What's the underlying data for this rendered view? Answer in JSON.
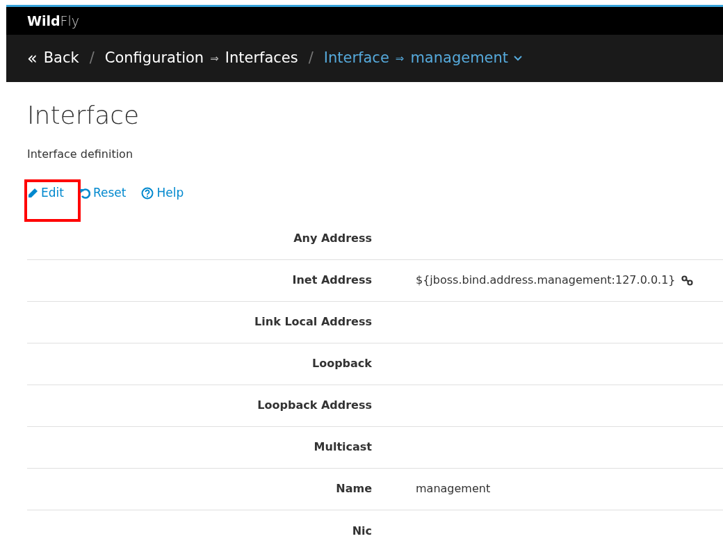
{
  "brand": {
    "bold": "Wild",
    "light": "Fly"
  },
  "breadcrumb": [
    {
      "kind": "back",
      "text": "«"
    },
    {
      "kind": "link",
      "text": "Back"
    },
    {
      "kind": "slash",
      "text": "/"
    },
    {
      "kind": "link",
      "text": "Configuration"
    },
    {
      "kind": "arrow",
      "text": "⇒"
    },
    {
      "kind": "link",
      "text": "Interfaces"
    },
    {
      "kind": "slash",
      "text": "/"
    },
    {
      "kind": "current",
      "text": "Interface"
    },
    {
      "kind": "current_arrow",
      "text": "⇒"
    },
    {
      "kind": "dropdown",
      "text": "management"
    }
  ],
  "title": "Interface",
  "description": "Interface definition",
  "actions": [
    {
      "label": "Edit",
      "kind": "edit",
      "highlighted": true
    },
    {
      "label": "Reset",
      "kind": "reset",
      "highlighted": false
    },
    {
      "label": "Help",
      "kind": "help",
      "highlighted": false
    }
  ],
  "rows": [
    {
      "label": "Any Address"
    },
    {
      "label": "Inet Address",
      "value": "${jboss.bind.address.management:127.0.0.1}",
      "kind": "expression"
    },
    {
      "label": "Link Local Address"
    },
    {
      "label": "Loopback"
    },
    {
      "label": "Loopback Address"
    },
    {
      "label": "Multicast"
    },
    {
      "label": "Name",
      "value": "management",
      "kind": "plain"
    },
    {
      "label": "Nic"
    }
  ]
}
